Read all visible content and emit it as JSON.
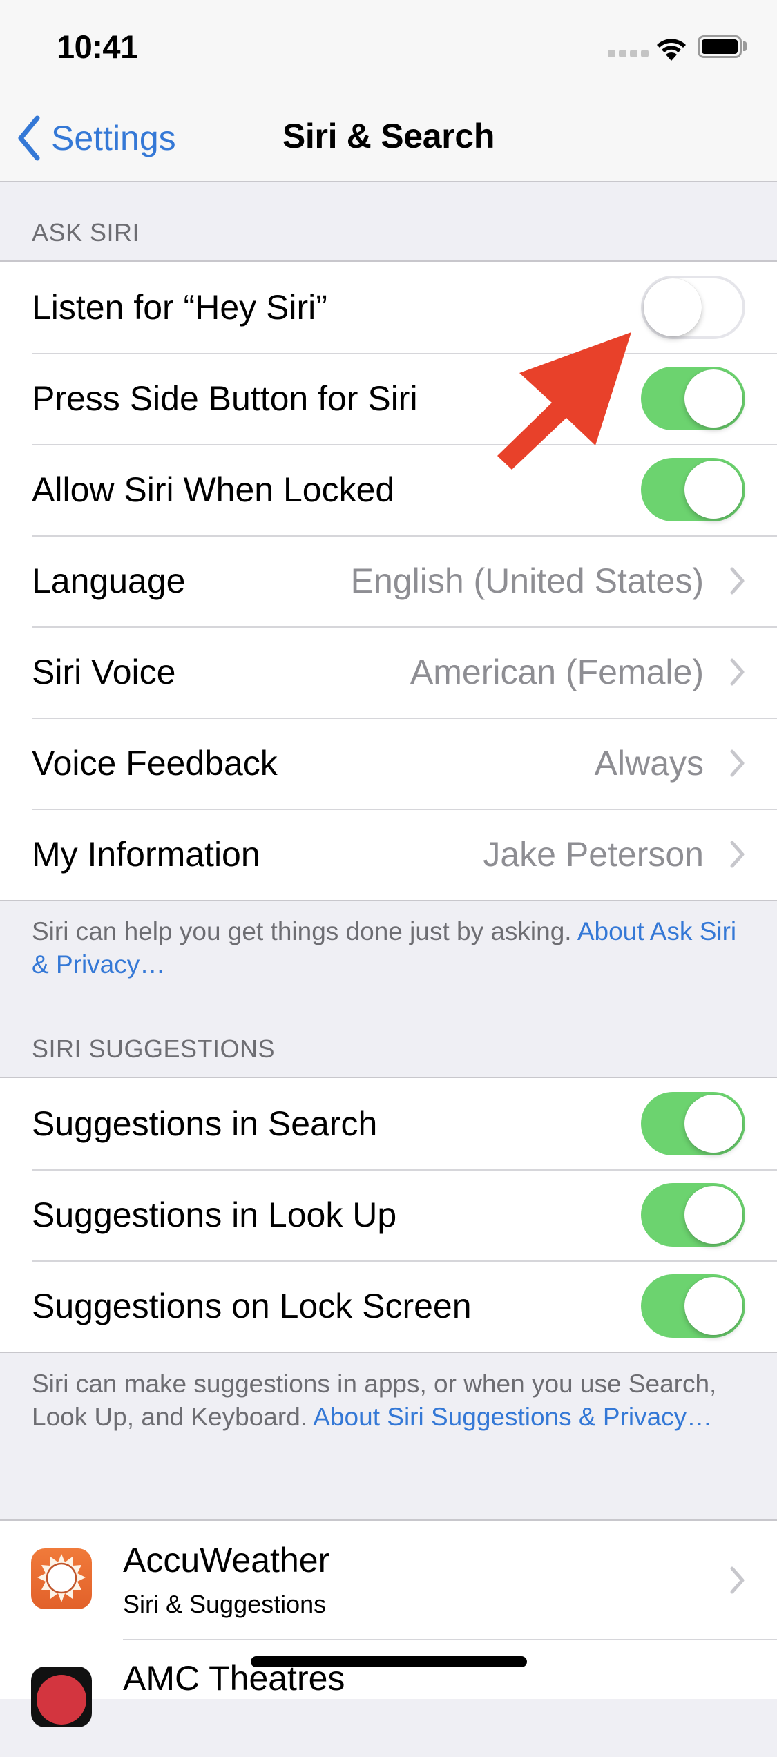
{
  "status_bar": {
    "time": "10:41",
    "icons": [
      "cellular-signal-icon",
      "wifi-icon",
      "battery-icon"
    ]
  },
  "nav": {
    "back_label": "Settings",
    "title": "Siri & Search"
  },
  "sections": {
    "ask_siri": {
      "header": "ASK SIRI",
      "rows": [
        {
          "label": "Listen for “Hey Siri”",
          "type": "toggle",
          "on": false
        },
        {
          "label": "Press Side Button for Siri",
          "type": "toggle",
          "on": true
        },
        {
          "label": "Allow Siri When Locked",
          "type": "toggle",
          "on": true
        },
        {
          "label": "Language",
          "type": "disclosure",
          "value": "English (United States)"
        },
        {
          "label": "Siri Voice",
          "type": "disclosure",
          "value": "American (Female)"
        },
        {
          "label": "Voice Feedback",
          "type": "disclosure",
          "value": "Always"
        },
        {
          "label": "My Information",
          "type": "disclosure",
          "value": "Jake Peterson"
        }
      ],
      "footer_text": "Siri can help you get things done just by asking. ",
      "footer_link": "About Ask Siri & Privacy…"
    },
    "siri_suggestions": {
      "header": "SIRI SUGGESTIONS",
      "rows": [
        {
          "label": "Suggestions in Search",
          "type": "toggle",
          "on": true
        },
        {
          "label": "Suggestions in Look Up",
          "type": "toggle",
          "on": true
        },
        {
          "label": "Suggestions on Lock Screen",
          "type": "toggle",
          "on": true
        }
      ],
      "footer_text": "Siri can make suggestions in apps, or when you use Search, Look Up, and Keyboard. ",
      "footer_link": "About Siri Suggestions & Privacy…"
    },
    "apps": {
      "rows": [
        {
          "name": "AccuWeather",
          "subtitle": "Siri & Suggestions",
          "icon": "accuweather-app-icon"
        },
        {
          "name": "AMC Theatres",
          "subtitle": "",
          "icon": "amc-theatres-app-icon"
        }
      ]
    }
  },
  "annotation": {
    "type": "red-arrow",
    "points_to": "Listen for “Hey Siri” toggle",
    "color": "#e8412a"
  },
  "colors": {
    "accent": "#3478d6",
    "toggle_on": "#6cd36f",
    "background": "#efeff4",
    "secondary_text": "#8e8e93",
    "footer_text": "#6d6d72"
  }
}
